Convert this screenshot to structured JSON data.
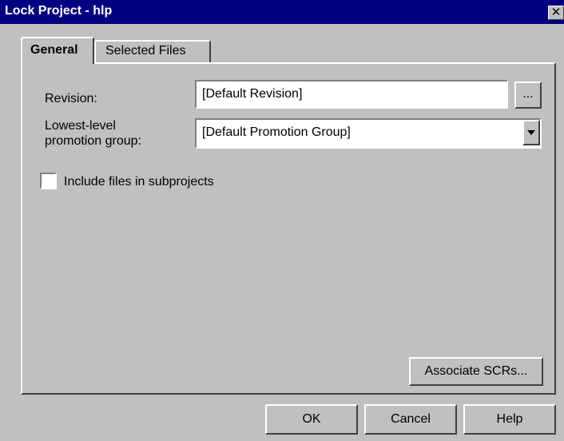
{
  "window": {
    "title": "Lock Project - hlp",
    "close_glyph": "✕"
  },
  "tabs": [
    {
      "label": "General",
      "selected": true
    },
    {
      "label": "Selected Files",
      "selected": false
    }
  ],
  "general": {
    "revision_label": "Revision:",
    "revision_value": "[Default Revision]",
    "browse_label": "...",
    "promotion_label_line1": "Lowest-level",
    "promotion_label_line2": "promotion group:",
    "promotion_value": "[Default Promotion Group]",
    "include_subprojects_label": "Include files in subprojects",
    "include_subprojects_checked": false,
    "associate_scrs_label": "Associate SCRs..."
  },
  "footer": {
    "ok_label": "OK",
    "cancel_label": "Cancel",
    "help_label": "Help"
  }
}
